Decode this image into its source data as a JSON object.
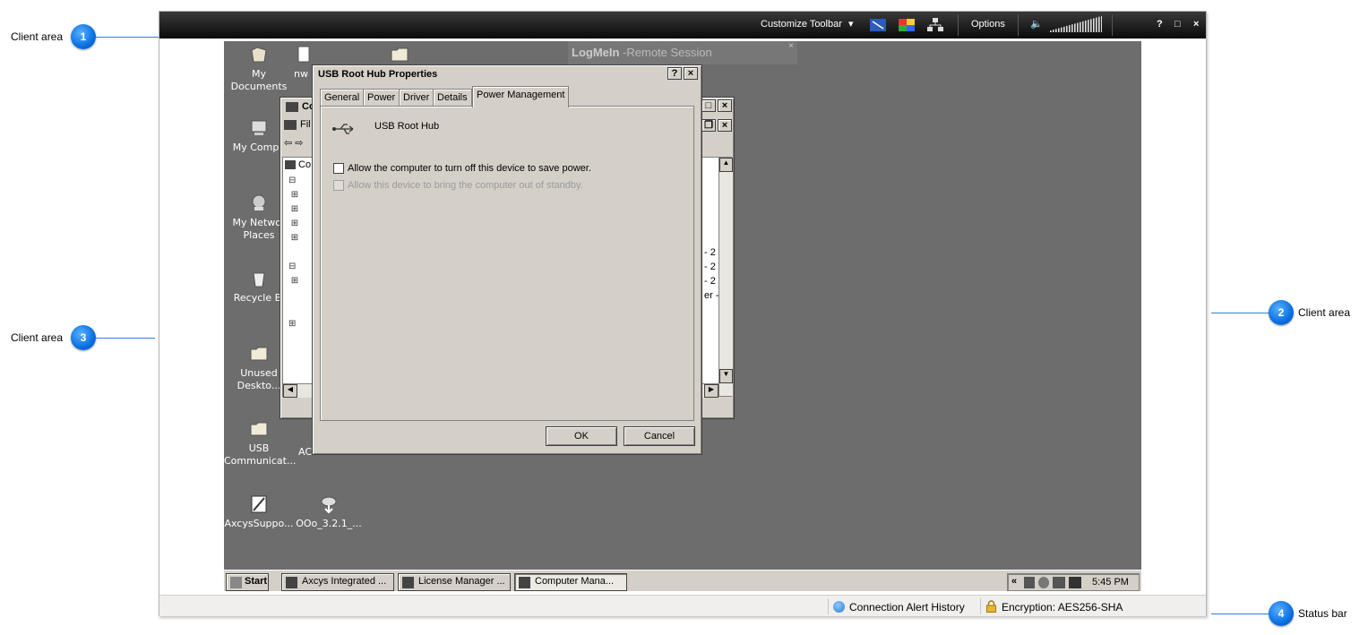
{
  "callouts": [
    {
      "number": "1",
      "label": "Client area"
    },
    {
      "number": "2",
      "label": "Client area"
    },
    {
      "number": "3",
      "label": "Client area"
    },
    {
      "number": "4",
      "label": "Status bar"
    }
  ],
  "toolbar": {
    "customize_label": "Customize Toolbar",
    "options_label": "Options",
    "help_label": "?",
    "maximize_label": "□",
    "close_label": "×"
  },
  "logmein": {
    "brand": "LogMeIn",
    "subtitle": " -Remote Session"
  },
  "desktop_icons": [
    {
      "label": "My Documents"
    },
    {
      "label": "nw"
    },
    {
      "label": "My Compu"
    },
    {
      "label": "My Networ\nPlaces"
    },
    {
      "label": "Recycle Bi"
    },
    {
      "label": "Unused\nDeskto..."
    },
    {
      "label": "USB\nCommunicat..."
    },
    {
      "label": "AC"
    },
    {
      "label": "AxcysSuppo..."
    },
    {
      "label": "OOo_3.2.1_..."
    }
  ],
  "background_window": {
    "title": "Co",
    "menu": "Fil",
    "tree_root": "Co",
    "right_items": [
      "- 2",
      "- 2",
      "- 2",
      "er -"
    ]
  },
  "dialog": {
    "title": "USB Root Hub Properties",
    "tabs": [
      "General",
      "Power",
      "Driver",
      "Details",
      "Power Management"
    ],
    "active_tab": "Power Management",
    "device_name": "USB Root Hub",
    "option1": "Allow the computer to turn off this device to save power.",
    "option2": "Allow this device to bring the computer out of standby.",
    "ok": "OK",
    "cancel": "Cancel"
  },
  "taskbar": {
    "start": "Start",
    "tasks": [
      {
        "label": "Axcys Integrated ..."
      },
      {
        "label": "License Manager    ..."
      },
      {
        "label": "Computer Mana..."
      }
    ],
    "tray_chevron": "«",
    "clock": "5:45 PM"
  },
  "statusbar": {
    "alert": "Connection Alert History",
    "encryption": "Encryption: AES256-SHA"
  }
}
